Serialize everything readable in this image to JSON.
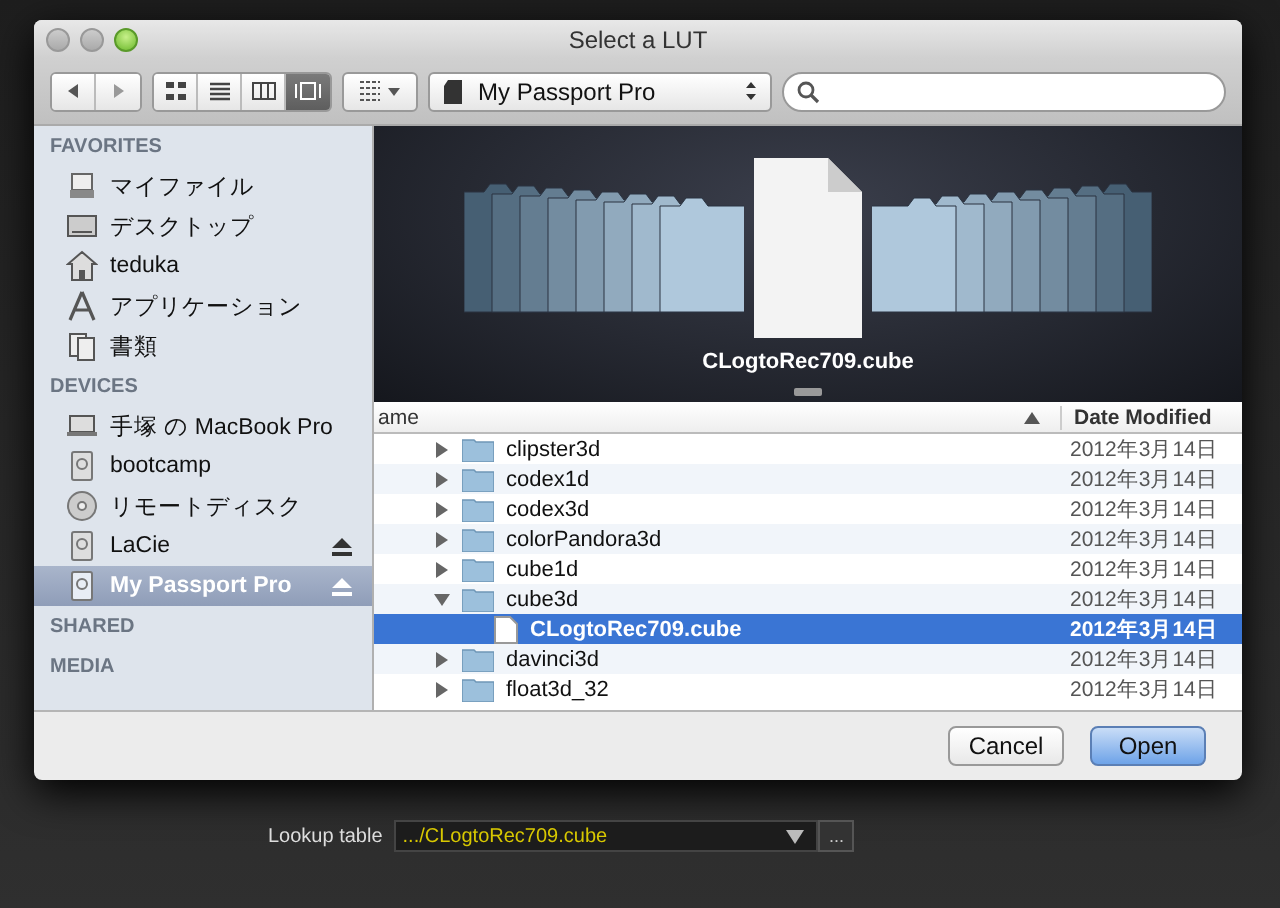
{
  "window": {
    "title": "Select a LUT"
  },
  "toolbar": {
    "view_buttons": [
      {
        "kind": "icons",
        "selected": false
      },
      {
        "kind": "list",
        "selected": false
      },
      {
        "kind": "columns",
        "selected": false
      },
      {
        "kind": "coverflow",
        "selected": true
      }
    ],
    "location": "My Passport Pro"
  },
  "sidebar": {
    "sections": [
      {
        "title": "FAVORITES",
        "items": [
          {
            "label": "マイファイル",
            "kind": "files",
            "selected": false,
            "eject": false
          },
          {
            "label": "デスクトップ",
            "kind": "desktop",
            "selected": false,
            "eject": false
          },
          {
            "label": "teduka",
            "kind": "home",
            "selected": false,
            "eject": false
          },
          {
            "label": "アプリケーション",
            "kind": "apps",
            "selected": false,
            "eject": false
          },
          {
            "label": "書類",
            "kind": "documents",
            "selected": false,
            "eject": false
          }
        ]
      },
      {
        "title": "DEVICES",
        "items": [
          {
            "label": "手塚 の MacBook Pro",
            "kind": "laptop",
            "selected": false,
            "eject": false
          },
          {
            "label": "bootcamp",
            "kind": "drive",
            "selected": false,
            "eject": false
          },
          {
            "label": "リモートディスク",
            "kind": "disc",
            "selected": false,
            "eject": false
          },
          {
            "label": "LaCie",
            "kind": "drive",
            "selected": false,
            "eject": true
          },
          {
            "label": "My Passport Pro",
            "kind": "drive",
            "selected": true,
            "eject": true
          }
        ]
      },
      {
        "title": "SHARED"
      },
      {
        "title": "MEDIA"
      }
    ]
  },
  "preview": {
    "caption": "CLogtoRec709.cube"
  },
  "file_list": {
    "columns": [
      "ame",
      "Date Modified"
    ],
    "rows": [
      {
        "name": "clipster3d",
        "kind": "folder",
        "date": "2012年3月14日",
        "expanded": false,
        "selected": false
      },
      {
        "name": "codex1d",
        "kind": "folder",
        "date": "2012年3月14日",
        "expanded": false,
        "selected": false
      },
      {
        "name": "codex3d",
        "kind": "folder",
        "date": "2012年3月14日",
        "expanded": false,
        "selected": false
      },
      {
        "name": "colorPandora3d",
        "kind": "folder",
        "date": "2012年3月14日",
        "expanded": false,
        "selected": false
      },
      {
        "name": "cube1d",
        "kind": "folder",
        "date": "2012年3月14日",
        "expanded": false,
        "selected": false
      },
      {
        "name": "cube3d",
        "kind": "folder",
        "date": "2012年3月14日",
        "expanded": true,
        "selected": false,
        "children": [
          {
            "name": "CLogtoRec709.cube",
            "kind": "file",
            "date": "2012年3月14日",
            "selected": true
          }
        ]
      },
      {
        "name": "davinci3d",
        "kind": "folder",
        "date": "2012年3月14日",
        "expanded": false,
        "selected": false
      },
      {
        "name": "float3d_32",
        "kind": "folder",
        "date": "2012年3月14日",
        "expanded": false,
        "selected": false
      }
    ]
  },
  "buttons": [
    {
      "label": "Cancel",
      "default": false
    },
    {
      "label": "Open",
      "default": true
    }
  ],
  "lookup": {
    "label": "Lookup table",
    "value": ".../CLogtoRec709.cube",
    "browse": "..."
  }
}
